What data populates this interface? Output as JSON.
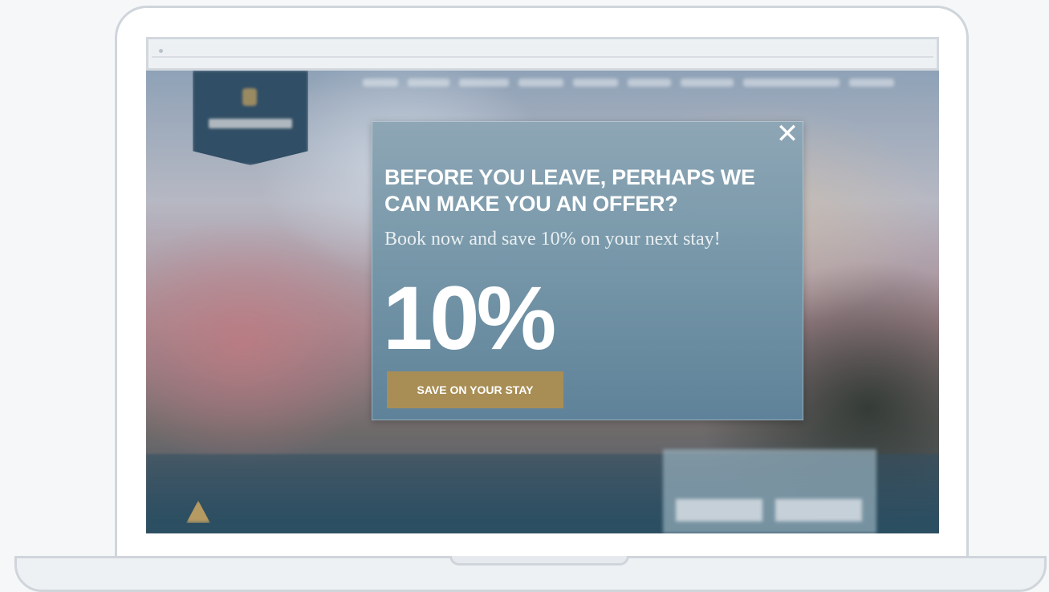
{
  "popup": {
    "close_glyph": "✕",
    "heading": "BEFORE YOU LEAVE, PERHAPS WE CAN MAKE YOU AN OFFER?",
    "subheading": "Book now and save 10% on your next stay!",
    "discount": "10%",
    "cta_label": "SAVE ON YOUR STAY"
  },
  "colors": {
    "cta": "#a88e55",
    "popup_bg": "#7a9aab",
    "frame": "#cfd5db"
  }
}
